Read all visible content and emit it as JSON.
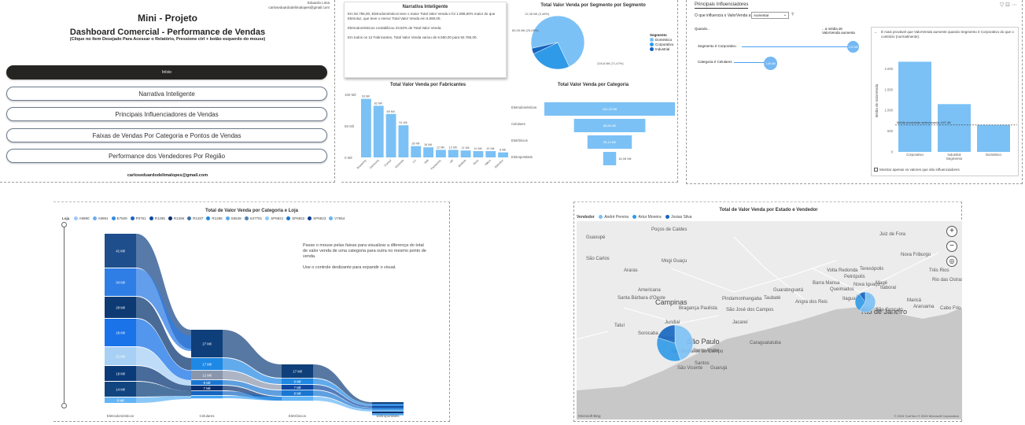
{
  "menu": {
    "user_name": "Eduardo Lima",
    "user_email": "carloseduardodelimalopes@gmail.com",
    "project": "Mini - Projeto",
    "title": "Dashboard Comercial - Performance de Vendas",
    "subtitle": "(Clique no Item Desejado Para Acessar o Relatório, Pressione ctrl + botão esquerdo do mouse)",
    "buttons": [
      "Início",
      "Narrativa Inteligente",
      "Principais Influenciadores de Vendas",
      "Faixas de Vendas Por Categoria e Pontos de Vendas",
      "Performance dos Vendedores Por Região"
    ],
    "footer_email": "carloseduardodelimalopes@gmail.com"
  },
  "narrative": {
    "title": "Narrativa Inteligente",
    "p1": "Em 92.786,00, Eletrodomésticos teve o maior Total Valor Venda e foi 1.088,60% maior do que Eletroluz, que teve o menor Total Valor Venda em 6.590,00.",
    "p2": "Eletrodomésticos contabilizou 23,82% de Total Valor Venda.",
    "p3": "Em todos os 12 Fabricantes, Total Valor Venda variou de 6.590,00 para 92.786,00."
  },
  "fabricantes_chart": {
    "title": "Total Valor Venda por Fabricantes",
    "chart_data": {
      "type": "bar",
      "categories": [
        "Brastemp",
        "Samsung",
        "Consul",
        "Motorola",
        "LG",
        "Dell",
        "Panasonic",
        "HP",
        "Britânia",
        "Sony",
        "Nikon",
        "Eletroluz"
      ],
      "values": [
        93,
        82,
        69,
        51,
        18,
        16,
        12,
        12,
        11,
        10,
        10,
        8
      ],
      "labels": [
        "93 Mil",
        "82 Mil",
        "69 Mil",
        "51 Mil",
        "18 Mil",
        "16 Mil",
        "12 Mil",
        "12 Mil",
        "11 Mil",
        "10 Mil",
        "10 Mil",
        "8 Mil",
        "7 Mil"
      ],
      "ylim": [
        0,
        100
      ],
      "yticks": [
        "100 Mil",
        "50 Mil",
        "0 Mil"
      ]
    }
  },
  "segmento_chart": {
    "title": "Total Valor Venda por Segmento por Segmento",
    "chart_data": {
      "type": "pie",
      "series": [
        {
          "name": "Doméstico",
          "value": 71.47,
          "label": "228,8 Mil (71,47%)",
          "color": "#7bc1f5"
        },
        {
          "name": "Corporativo",
          "value": 25.05,
          "label": "80,05 Mil (25,05%)",
          "color": "#2f9ae8"
        },
        {
          "name": "Industrial",
          "value": 3.48,
          "label": "12,38 Mil (3,48%)",
          "color": "#1565c0"
        }
      ]
    },
    "legend_title": "Segmento",
    "legend": [
      "Doméstico",
      "Corporativo",
      "Industrial"
    ]
  },
  "categoria_chart": {
    "title": "Total Valor Venda por Categoria",
    "chart_data": {
      "type": "bar",
      "categories": [
        "Eletrodomésticos",
        "Celulares",
        "Eletrônicos",
        "Eletroportáteis"
      ],
      "values": [
        162.25,
        88.66,
        55.13,
        16.06
      ],
      "labels": [
        "162,25 Mil",
        "88,66 Mil",
        "55,13 Mil",
        "16,06 Mil"
      ]
    }
  },
  "influencers": {
    "tab": "Principais Influenciadores",
    "question_prefix": "O que influencia o ValorVenda a",
    "dropdown": "Aumentar",
    "when_label": "Quando...",
    "avg_label": "...a média de ValorVenda aumenta",
    "rows": [
      {
        "label": "Segmento é Corporativo",
        "value": "1,22 Mil"
      },
      {
        "label": "Categoria é Celulares",
        "value": "1,46 Mil"
      }
    ],
    "explain": "É mais provável que ValorVenda aumente quando Segmento é Corporativo do que o contrário (normalmente).",
    "chart_data": {
      "type": "bar",
      "categories": [
        "Corporativo",
        "Industrial",
        "Doméstico"
      ],
      "values": [
        2170,
        1150,
        650
      ],
      "ylim": [
        0,
        2500
      ],
      "yticks": [
        "2.000",
        "1.500",
        "1.000",
        "500",
        "0"
      ],
      "ylabel": "Média de ValorVenda",
      "xlabel": "Segmento",
      "avg_line": 647.48,
      "avg_label": "Média (excluindo selecionado): 647,48"
    },
    "checkbox_label": "Mostrar apenas os valores que são influenciadores"
  },
  "sankey": {
    "title": "Total de Valor Venda por Categoria e Loja",
    "legend_prefix": "Loja",
    "legend": [
      "A9990",
      "A9991",
      "E7509",
      "P0761",
      "R1285",
      "R1286",
      "R1287",
      "R1288",
      "S6549",
      "S47781",
      "SP6821",
      "SP6822",
      "SP6823",
      "V7654"
    ],
    "legend_colors": [
      "#9fc9f5",
      "#6aaef0",
      "#2f8fe0",
      "#1565c0",
      "#0d47a1",
      "#0a2f6e",
      "#3b6ea8",
      "#1e88e5",
      "#5aa9ee",
      "#4f83b8",
      "#90caf9",
      "#1976d2",
      "#0b3d91",
      "#64b5f6"
    ],
    "note1": "Passe o mouse pelas faixas para visualizar a diferença do total  de valor venda de uma categoria para outra no mesmo ponto de venda.",
    "note2": "Use o controle deslizante para expandir o visual.",
    "chart_data": {
      "type": "sankey",
      "categories": [
        "Eletrodomésticos",
        "Celulares",
        "Eletrônicos",
        "Eletroportáteis"
      ],
      "segments": [
        [
          "41 Mil",
          "34 Mil",
          "28 Mil",
          "28 Mil",
          "21 Mil",
          "18 Mil",
          "14 Mil",
          "8 Mil"
        ],
        [
          "27 Mil",
          "17 Mil",
          "12 Mil",
          "8 Mil",
          "7 Mil"
        ],
        [
          "17 Mil",
          "8 Mil",
          "7 Mil",
          "8 Mil"
        ],
        []
      ]
    }
  },
  "map": {
    "title": "Total de Valor Venda por Estado e Vendedor",
    "legend_prefix": "Vendedor",
    "legend": [
      "André Pereira",
      "Artur Moreira",
      "Josias Silva"
    ],
    "legend_colors": [
      "#7bc1f5",
      "#2f9ae8",
      "#1565c0"
    ],
    "places": [
      "Poços de Caldes",
      "Guaxupé",
      "São Carlos",
      "Araras",
      "Mogi Guaçu",
      "Americana",
      "Campinas",
      "Santa Bárbara d'Oeste",
      "Bragança Paulista",
      "Jundiaí",
      "Sorocaba",
      "Tatuí",
      "Osasco",
      "São Paulo",
      "São Bernardo do Campo",
      "Santo André",
      "Santos",
      "São Vicente",
      "Guarujá",
      "Caraguatatuba",
      "São José dos Campos",
      "Jacareí",
      "Taubaté",
      "Pindamonhangaba",
      "Guaratinguetá",
      "Volta Redonda",
      "Barra Mansa",
      "Angra dos Reis",
      "Queimados",
      "Itaguaí",
      "Nova Iguaçu",
      "Magé",
      "Niterói",
      "São Gonçalo",
      "Rio de Janeiro",
      "Juiz de Fora",
      "Teresópolis",
      "Petrópolis",
      "Nova Friburgo",
      "Três Rios",
      "Itaboraí",
      "Maricá",
      "Araruama",
      "Cabo Frio",
      "Rio das Ostras"
    ],
    "copyright": "© 2024 TomTom © 2024 Microsoft Corporation",
    "bing": "Microsoft Bing"
  }
}
